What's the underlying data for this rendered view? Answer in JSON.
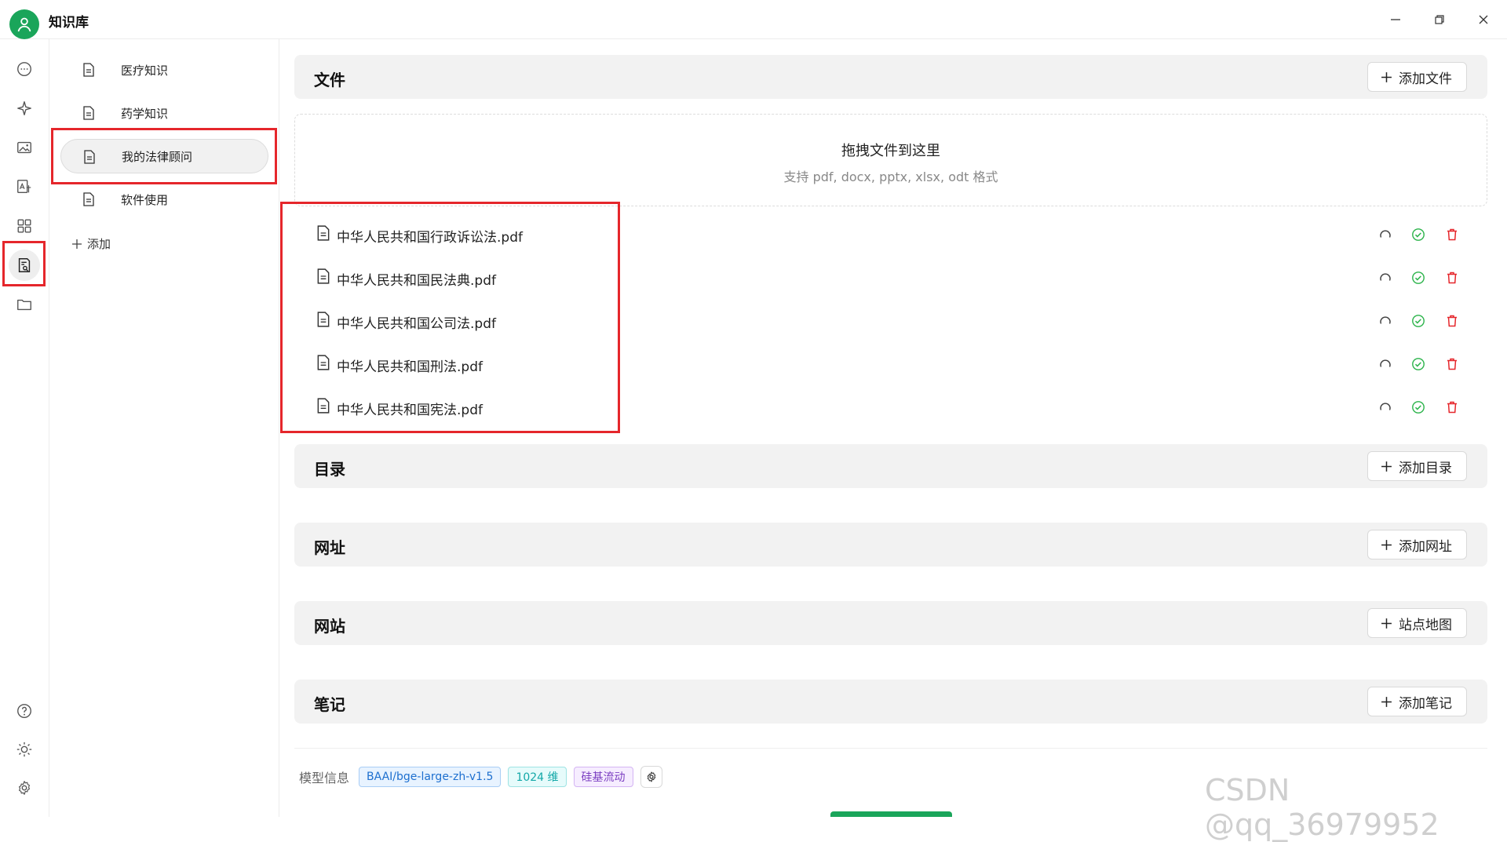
{
  "app": {
    "title": "知识库"
  },
  "kb_list": {
    "items": [
      {
        "label": "医疗知识"
      },
      {
        "label": "药学知识"
      },
      {
        "label": "我的法律顾问"
      },
      {
        "label": "软件使用"
      }
    ],
    "add_label": "添加"
  },
  "sections": {
    "files": {
      "title": "文件",
      "button": "添加文件"
    },
    "dirs": {
      "title": "目录",
      "button": "添加目录"
    },
    "urls": {
      "title": "网址",
      "button": "添加网址"
    },
    "sites": {
      "title": "网站",
      "button": "站点地图"
    },
    "notes": {
      "title": "笔记",
      "button": "添加笔记"
    }
  },
  "dropzone": {
    "title": "拖拽文件到这里",
    "subtitle": "支持 pdf, docx, pptx, xlsx, odt 格式"
  },
  "files": [
    {
      "name": "中华人民共和国行政诉讼法.pdf"
    },
    {
      "name": "中华人民共和国民法典.pdf"
    },
    {
      "name": "中华人民共和国公司法.pdf"
    },
    {
      "name": "中华人民共和国刑法.pdf"
    },
    {
      "name": "中华人民共和国宪法.pdf"
    }
  ],
  "footer": {
    "label": "模型信息",
    "model": "BAAI/bge-large-zh-v1.5",
    "dims": "1024 维",
    "provider": "硅基流动"
  },
  "watermark": "CSDN @qq_36979952",
  "colors": {
    "accent": "#1aa55a",
    "highlight": "#e5262b",
    "delete": "#e5262b",
    "ok": "#2bb34a"
  },
  "icons": [
    "user-icon",
    "chat-icon",
    "sparkle-icon",
    "image-icon",
    "translate-icon",
    "apps-icon",
    "knowledge-icon",
    "folder-icon",
    "help-icon",
    "sun-icon",
    "settings-icon",
    "document-icon",
    "plus-icon",
    "refresh-icon",
    "check-circle-icon",
    "trash-icon"
  ]
}
